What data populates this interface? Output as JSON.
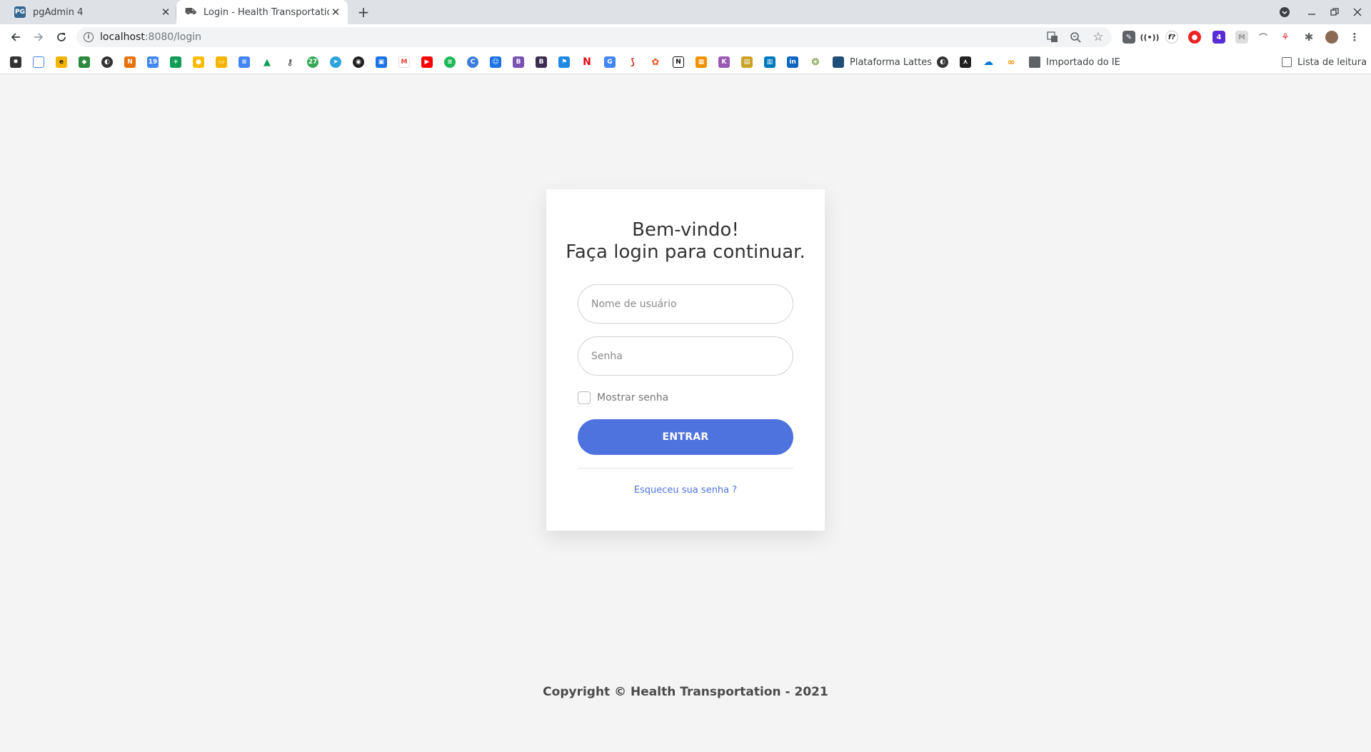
{
  "browser": {
    "tabs": [
      {
        "title": "pgAdmin 4",
        "icon": "pgadmin-icon",
        "active": false
      },
      {
        "title": "Login - Health Transportation",
        "icon": "health-transport-icon",
        "active": true
      }
    ],
    "new_tab_symbol": "+",
    "url_host": "localhost",
    "url_path": ":8080/login",
    "bookmarks": {
      "plataforma_lattes": "Plataforma Lattes",
      "importado_ie": "Importado do IE",
      "reading_list": "Lista de leitura"
    }
  },
  "login": {
    "heading_line1": "Bem-vindo!",
    "heading_line2": "Faça login para continuar.",
    "username_placeholder": "Nome de usuário",
    "password_placeholder": "Senha",
    "show_password_label": "Mostrar senha",
    "submit_label": "ENTRAR",
    "forgot_label": "Esqueceu sua senha ?"
  },
  "footer": {
    "copyright": "Copyright © Health Transportation - 2021"
  },
  "colors": {
    "accent": "#4e73df",
    "page_bg": "#f4f4f4"
  }
}
